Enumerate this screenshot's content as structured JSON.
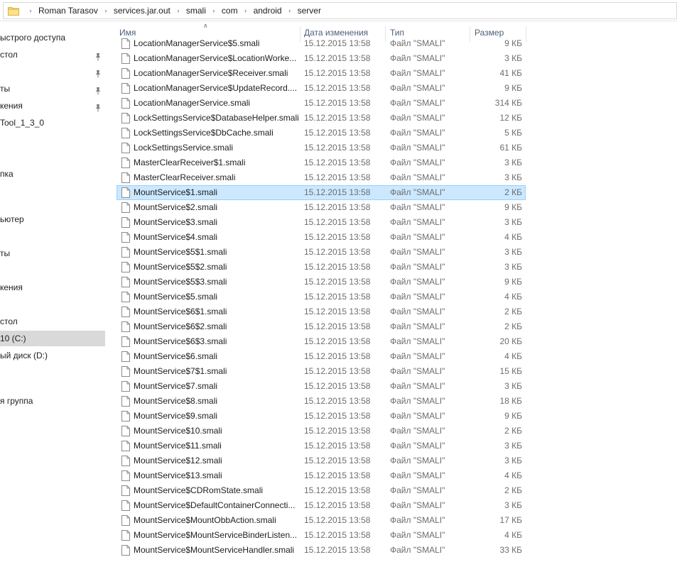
{
  "address": {
    "crumbs": [
      "Roman Tarasov",
      "services.jar.out",
      "smali",
      "com",
      "android",
      "server"
    ]
  },
  "nav": {
    "items": [
      {
        "label": "ыстрого доступа",
        "pinned": false,
        "selected": false
      },
      {
        "label": "стол",
        "pinned": true,
        "selected": false
      },
      {
        "label": "",
        "pinned": true,
        "selected": false
      },
      {
        "label": "ты",
        "pinned": true,
        "selected": false
      },
      {
        "label": "кения",
        "pinned": true,
        "selected": false
      },
      {
        "label": "Tool_1_3_0",
        "pinned": false,
        "selected": false
      },
      {
        "label": "пка",
        "pinned": false,
        "selected": false
      },
      {
        "label": "ьютер",
        "pinned": false,
        "selected": false
      },
      {
        "label": "ты",
        "pinned": false,
        "selected": false
      },
      {
        "label": "",
        "pinned": false,
        "selected": false
      },
      {
        "label": "кения",
        "pinned": false,
        "selected": false
      },
      {
        "label": "стол",
        "pinned": false,
        "selected": false
      },
      {
        "label": "10 (C:)",
        "pinned": false,
        "selected": true
      },
      {
        "label": "ый диск (D:)",
        "pinned": false,
        "selected": false
      },
      {
        "label": "я группа",
        "pinned": false,
        "selected": false
      }
    ]
  },
  "columns": {
    "name": "Имя",
    "date": "Дата изменения",
    "type": "Тип",
    "size": "Размер"
  },
  "files": [
    {
      "name": "LocationManagerService$5.smali",
      "date": "15.12.2015 13:58",
      "type": "Файл \"SMALI\"",
      "size": "9 КБ"
    },
    {
      "name": "LocationManagerService$LocationWorke...",
      "date": "15.12.2015 13:58",
      "type": "Файл \"SMALI\"",
      "size": "3 КБ"
    },
    {
      "name": "LocationManagerService$Receiver.smali",
      "date": "15.12.2015 13:58",
      "type": "Файл \"SMALI\"",
      "size": "41 КБ"
    },
    {
      "name": "LocationManagerService$UpdateRecord....",
      "date": "15.12.2015 13:58",
      "type": "Файл \"SMALI\"",
      "size": "9 КБ"
    },
    {
      "name": "LocationManagerService.smali",
      "date": "15.12.2015 13:58",
      "type": "Файл \"SMALI\"",
      "size": "314 КБ"
    },
    {
      "name": "LockSettingsService$DatabaseHelper.smali",
      "date": "15.12.2015 13:58",
      "type": "Файл \"SMALI\"",
      "size": "12 КБ"
    },
    {
      "name": "LockSettingsService$DbCache.smali",
      "date": "15.12.2015 13:58",
      "type": "Файл \"SMALI\"",
      "size": "5 КБ"
    },
    {
      "name": "LockSettingsService.smali",
      "date": "15.12.2015 13:58",
      "type": "Файл \"SMALI\"",
      "size": "61 КБ"
    },
    {
      "name": "MasterClearReceiver$1.smali",
      "date": "15.12.2015 13:58",
      "type": "Файл \"SMALI\"",
      "size": "3 КБ"
    },
    {
      "name": "MasterClearReceiver.smali",
      "date": "15.12.2015 13:58",
      "type": "Файл \"SMALI\"",
      "size": "3 КБ"
    },
    {
      "name": "MountService$1.smali",
      "date": "15.12.2015 13:58",
      "type": "Файл \"SMALI\"",
      "size": "2 КБ",
      "selected": true
    },
    {
      "name": "MountService$2.smali",
      "date": "15.12.2015 13:58",
      "type": "Файл \"SMALI\"",
      "size": "9 КБ"
    },
    {
      "name": "MountService$3.smali",
      "date": "15.12.2015 13:58",
      "type": "Файл \"SMALI\"",
      "size": "3 КБ"
    },
    {
      "name": "MountService$4.smali",
      "date": "15.12.2015 13:58",
      "type": "Файл \"SMALI\"",
      "size": "4 КБ"
    },
    {
      "name": "MountService$5$1.smali",
      "date": "15.12.2015 13:58",
      "type": "Файл \"SMALI\"",
      "size": "3 КБ"
    },
    {
      "name": "MountService$5$2.smali",
      "date": "15.12.2015 13:58",
      "type": "Файл \"SMALI\"",
      "size": "3 КБ"
    },
    {
      "name": "MountService$5$3.smali",
      "date": "15.12.2015 13:58",
      "type": "Файл \"SMALI\"",
      "size": "9 КБ"
    },
    {
      "name": "MountService$5.smali",
      "date": "15.12.2015 13:58",
      "type": "Файл \"SMALI\"",
      "size": "4 КБ"
    },
    {
      "name": "MountService$6$1.smali",
      "date": "15.12.2015 13:58",
      "type": "Файл \"SMALI\"",
      "size": "2 КБ"
    },
    {
      "name": "MountService$6$2.smali",
      "date": "15.12.2015 13:58",
      "type": "Файл \"SMALI\"",
      "size": "2 КБ"
    },
    {
      "name": "MountService$6$3.smali",
      "date": "15.12.2015 13:58",
      "type": "Файл \"SMALI\"",
      "size": "20 КБ"
    },
    {
      "name": "MountService$6.smali",
      "date": "15.12.2015 13:58",
      "type": "Файл \"SMALI\"",
      "size": "4 КБ"
    },
    {
      "name": "MountService$7$1.smali",
      "date": "15.12.2015 13:58",
      "type": "Файл \"SMALI\"",
      "size": "15 КБ"
    },
    {
      "name": "MountService$7.smali",
      "date": "15.12.2015 13:58",
      "type": "Файл \"SMALI\"",
      "size": "3 КБ"
    },
    {
      "name": "MountService$8.smali",
      "date": "15.12.2015 13:58",
      "type": "Файл \"SMALI\"",
      "size": "18 КБ"
    },
    {
      "name": "MountService$9.smali",
      "date": "15.12.2015 13:58",
      "type": "Файл \"SMALI\"",
      "size": "9 КБ"
    },
    {
      "name": "MountService$10.smali",
      "date": "15.12.2015 13:58",
      "type": "Файл \"SMALI\"",
      "size": "2 КБ"
    },
    {
      "name": "MountService$11.smali",
      "date": "15.12.2015 13:58",
      "type": "Файл \"SMALI\"",
      "size": "3 КБ"
    },
    {
      "name": "MountService$12.smali",
      "date": "15.12.2015 13:58",
      "type": "Файл \"SMALI\"",
      "size": "3 КБ"
    },
    {
      "name": "MountService$13.smali",
      "date": "15.12.2015 13:58",
      "type": "Файл \"SMALI\"",
      "size": "4 КБ"
    },
    {
      "name": "MountService$CDRomState.smali",
      "date": "15.12.2015 13:58",
      "type": "Файл \"SMALI\"",
      "size": "2 КБ"
    },
    {
      "name": "MountService$DefaultContainerConnecti...",
      "date": "15.12.2015 13:58",
      "type": "Файл \"SMALI\"",
      "size": "3 КБ"
    },
    {
      "name": "MountService$MountObbAction.smali",
      "date": "15.12.2015 13:58",
      "type": "Файл \"SMALI\"",
      "size": "17 КБ"
    },
    {
      "name": "MountService$MountServiceBinderListen...",
      "date": "15.12.2015 13:58",
      "type": "Файл \"SMALI\"",
      "size": "4 КБ"
    },
    {
      "name": "MountService$MountServiceHandler.smali",
      "date": "15.12.2015 13:58",
      "type": "Файл \"SMALI\"",
      "size": "33 КБ"
    }
  ]
}
